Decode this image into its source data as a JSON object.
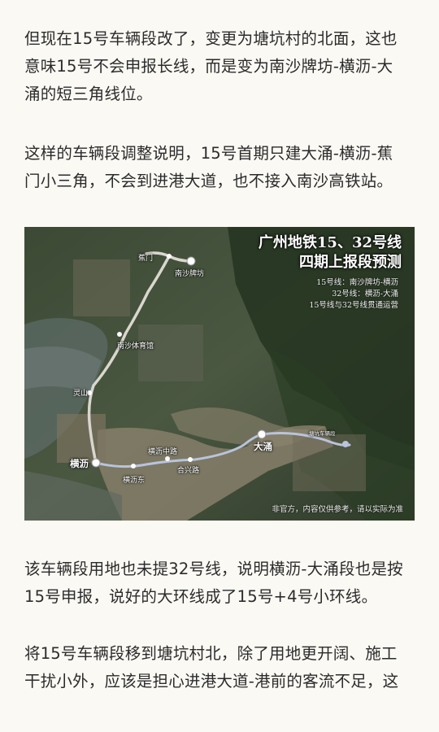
{
  "paragraphs": {
    "p1": [
      "但现在15号车辆段改了，变更为塘坑村的北面，这也",
      "意味15号不会申报长线，而是变为南沙牌坊-横沥-大",
      "涌的短三角线位。"
    ],
    "p2": [
      "这样的车辆段调整说明，15号首期只建大涌-横沥-蕉",
      "门小三角，不会到进港大道，也不接入南沙高铁站。"
    ],
    "p3": [
      "该车辆段用地也未提32号线，说明横沥-大涌段也是按",
      "15号申报，说好的大环线成了15号+4号小环线。"
    ],
    "p4": [
      "将15号车辆段移到塘坑村北，除了用地更开阔、施工",
      "干扰小外，应该是担心进港大道-港前的客流不足，这"
    ]
  },
  "map": {
    "title_line1": "广州地铁15、32号线",
    "title_line2": "四期上报段预测",
    "legend": [
      "15号线：南沙牌坊-横沥",
      "32号线：横沥-大涌",
      "15号线与32号线贯通运营"
    ],
    "note": "非官方，内容仅供参考，请以实际为准",
    "stations": {
      "jiaomen": "蕉门",
      "nansha_paifang": "南沙牌坊",
      "nansha_tiyuguan": "南沙体育馆",
      "lingshan": "灵山",
      "hengli": "横沥",
      "hengli_zhonglu": "横沥中路",
      "hengli_dong": "横沥东",
      "hexing_lu": "合兴路",
      "dayong": "大涌",
      "depot": "塘坑车辆段"
    },
    "colors": {
      "line15": "#d9d6cf",
      "line32": "#b9c3dc"
    }
  }
}
